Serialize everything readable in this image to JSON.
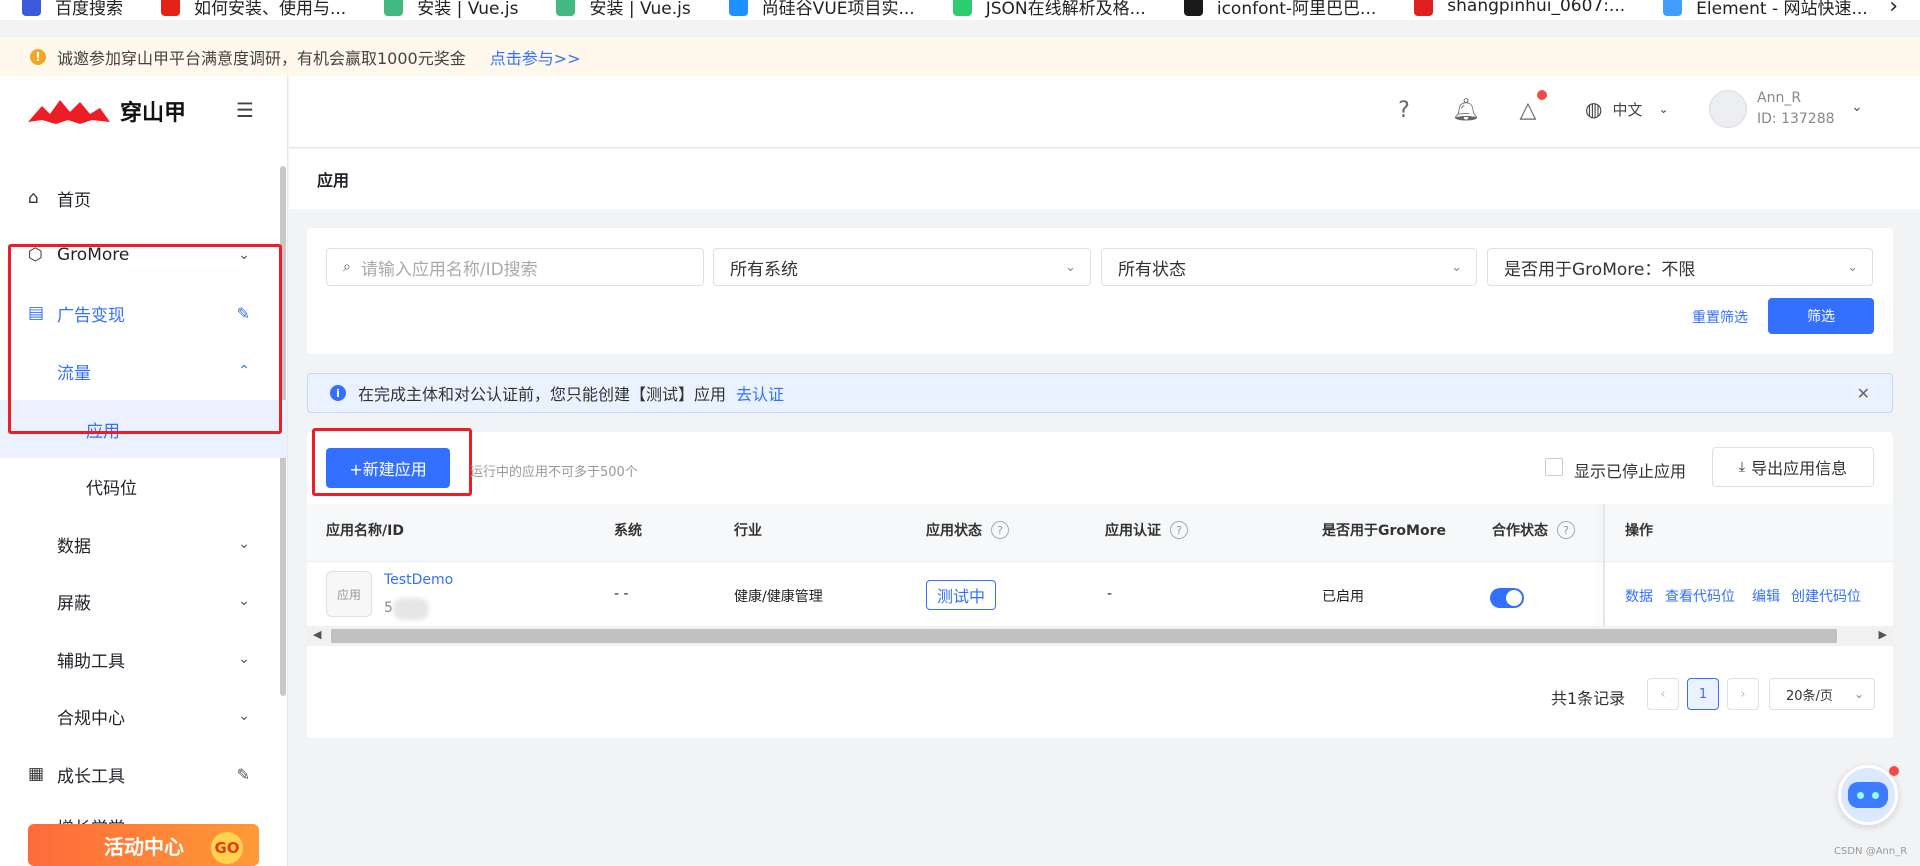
{
  "bookmarks": [
    "百度搜索",
    "如何安装、使用与...",
    "安装 | Vue.js",
    "安装 | Vue.js",
    "尚硅谷VUE项目实...",
    "JSON在线解析及格...",
    "iconfont-阿里巴巴...",
    "shangpinhui_0607:...",
    "Element - 网站快速..."
  ],
  "bookmark_colors": [
    "#3b5bdb",
    "#e62117",
    "#42b883",
    "#42b883",
    "#1e90ff",
    "#2ecc71",
    "#1a1a1a",
    "#e0201e",
    "#409eff"
  ],
  "notice": {
    "text": "诚邀参加穿山甲平台满意度调研，有机会赢取1000元奖金",
    "link": "点击参与>>"
  },
  "brand": {
    "name": "穿山甲",
    "accent": "#3370ff",
    "logo_red": "#ee1c25"
  },
  "sidebar": {
    "items": [
      {
        "label": "首页",
        "icon": "home-icon"
      },
      {
        "label": "GroMore",
        "icon": "hexagon-icon"
      },
      {
        "label": "广告变现",
        "icon": "chart-icon"
      },
      {
        "label": "流量"
      },
      {
        "label": "应用"
      },
      {
        "label": "代码位"
      },
      {
        "label": "数据"
      },
      {
        "label": "屏蔽"
      },
      {
        "label": "辅助工具"
      },
      {
        "label": "合规中心"
      },
      {
        "label": "成长工具",
        "icon": "grid-icon"
      },
      {
        "label": "增长学堂"
      }
    ],
    "promo": "活动中心",
    "promo_go": "GO"
  },
  "topbar": {
    "language": "中文",
    "user_name": "Ann_R",
    "user_id": "ID: 137288"
  },
  "page_title": "应用",
  "filters": {
    "search_placeholder": "请输入应用名称/ID搜索",
    "system": "所有系统",
    "status": "所有状态",
    "gromore": "是否用于GroMore：不限",
    "reset": "重置筛选",
    "submit": "筛选"
  },
  "alert": {
    "text": "在完成主体和对公认证前，您只能创建【测试】应用",
    "link": "去认证"
  },
  "toolbar": {
    "new_app": "+新建应用",
    "hint": "运行中的应用不可多于500个",
    "show_stopped": "显示已停止应用",
    "export": "导出应用信息"
  },
  "table": {
    "headers": [
      "应用名称/ID",
      "系统",
      "行业",
      "应用状态",
      "应用认证",
      "是否用于GroMore",
      "合作状态",
      "操作"
    ],
    "rows": [
      {
        "thumb": "应用",
        "name": "TestDemo",
        "id": "5     0",
        "system": "- -",
        "industry": "健康/健康管理",
        "status": "测试中",
        "cert": "-",
        "gromore": "已启用",
        "coop": true,
        "ops": [
          "数据",
          "查看代码位",
          "编辑",
          "创建代码位"
        ]
      }
    ]
  },
  "pagination": {
    "total": "共1条记录",
    "current": "1",
    "page_size": "20条/页"
  },
  "watermark": "CSDN @Ann_R"
}
